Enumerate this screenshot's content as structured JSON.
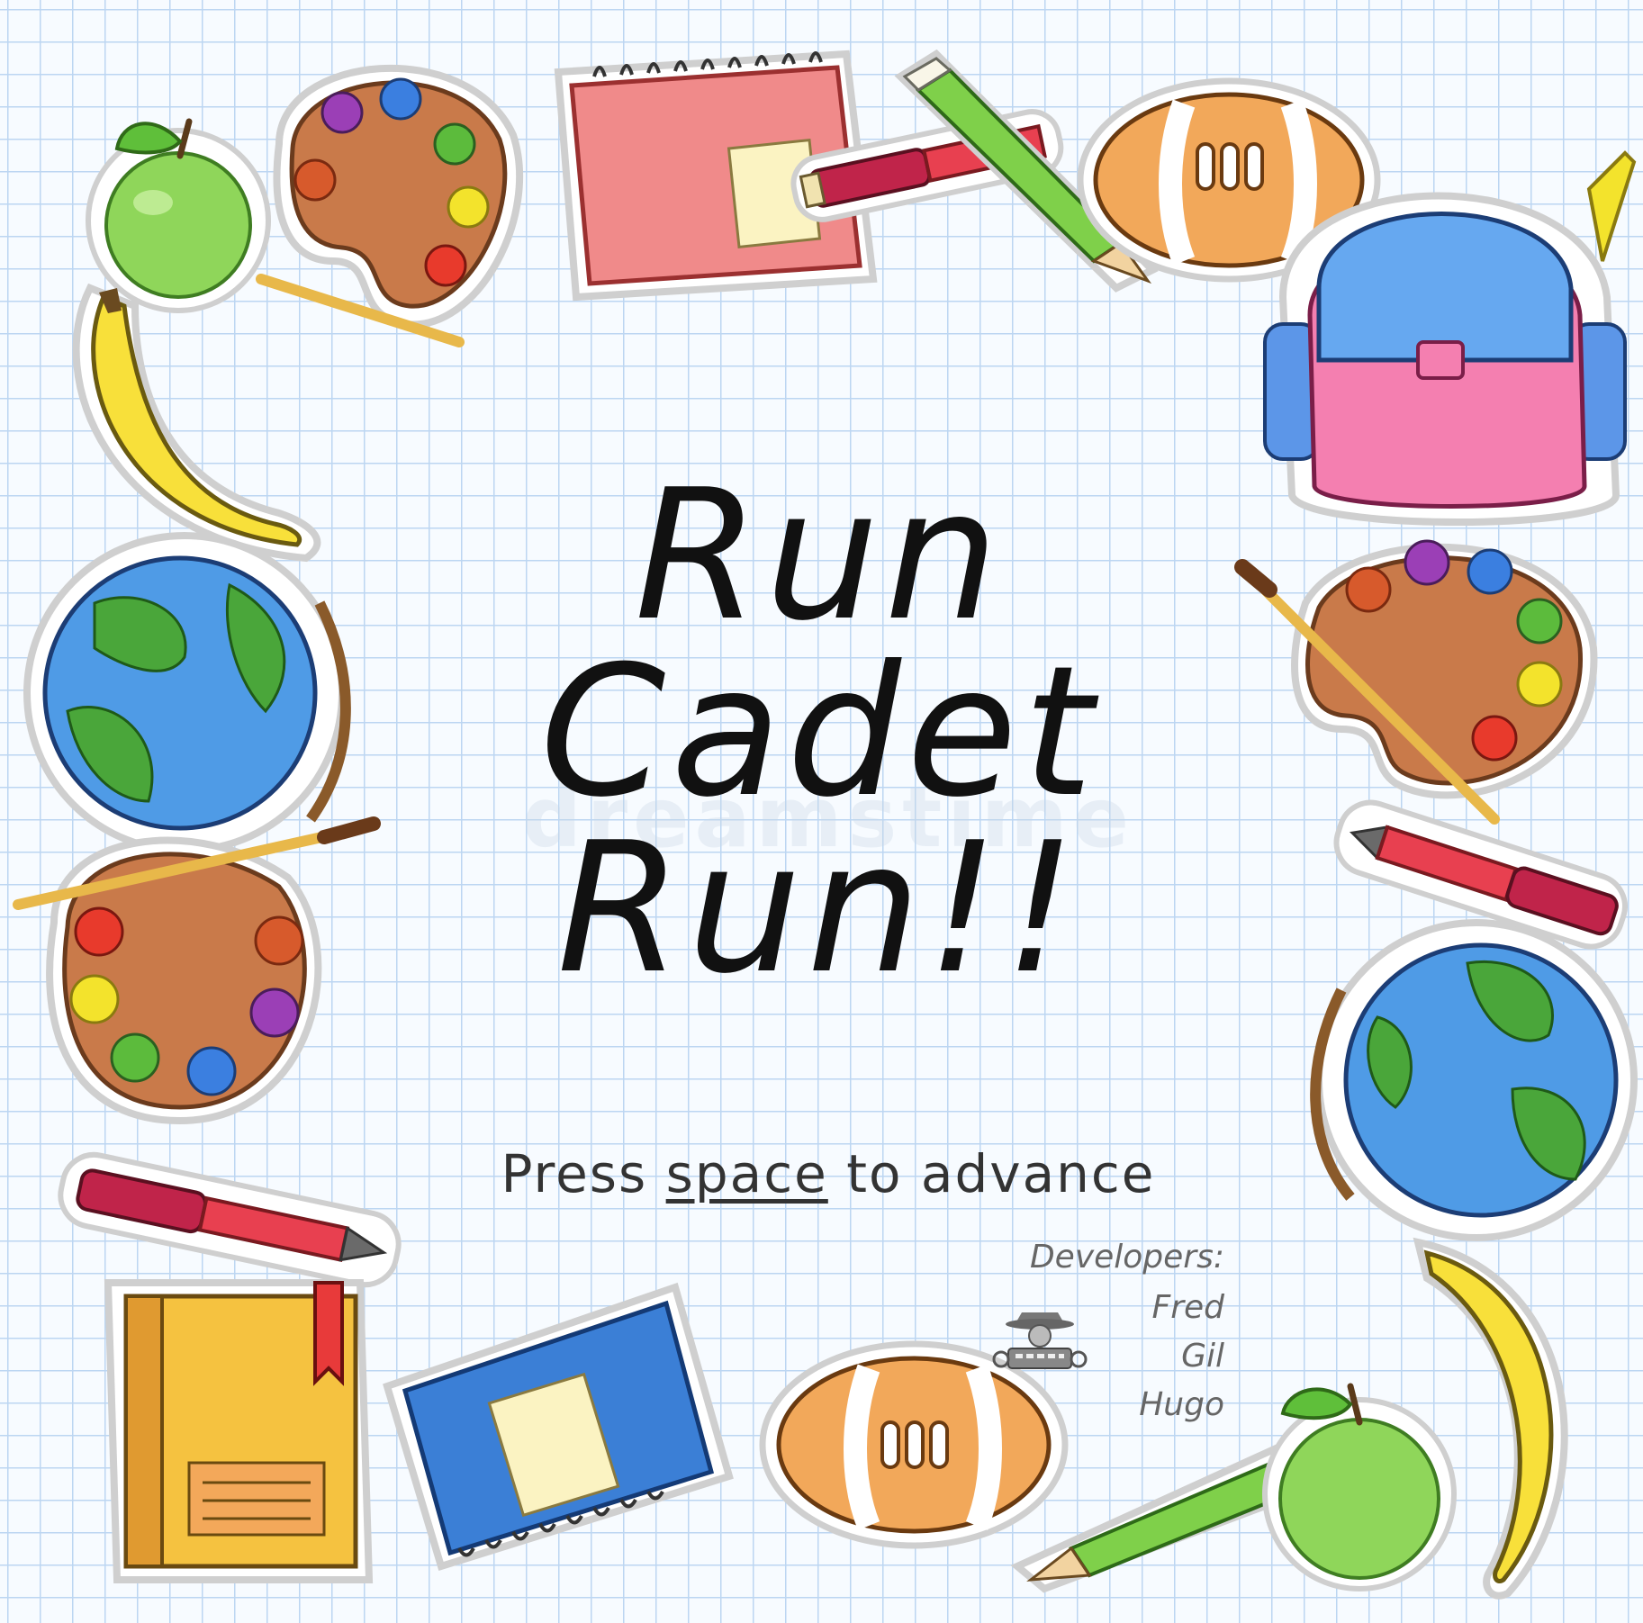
{
  "title": {
    "line1": "Run",
    "line2": "Cadet",
    "line3": "Run!!"
  },
  "prompt": {
    "before": "Press ",
    "key": "space",
    "after": " to advance"
  },
  "developers": {
    "heading": "Developers:",
    "names": [
      "Fred",
      "Gil",
      "Hugo"
    ]
  },
  "watermark": "dreamstime",
  "colors": {
    "paper": "#f7fbff",
    "grid": "#bcd6f2",
    "title_ink": "#111111",
    "sticker_outline": "#c9c9c9"
  },
  "stickers": [
    "apple-icon",
    "paint-palette-icon",
    "notebook-icon",
    "pencil-icon",
    "pen-icon",
    "football-icon",
    "backpack-icon",
    "banana-icon",
    "globe-icon",
    "book-icon",
    "ruler-icon"
  ]
}
